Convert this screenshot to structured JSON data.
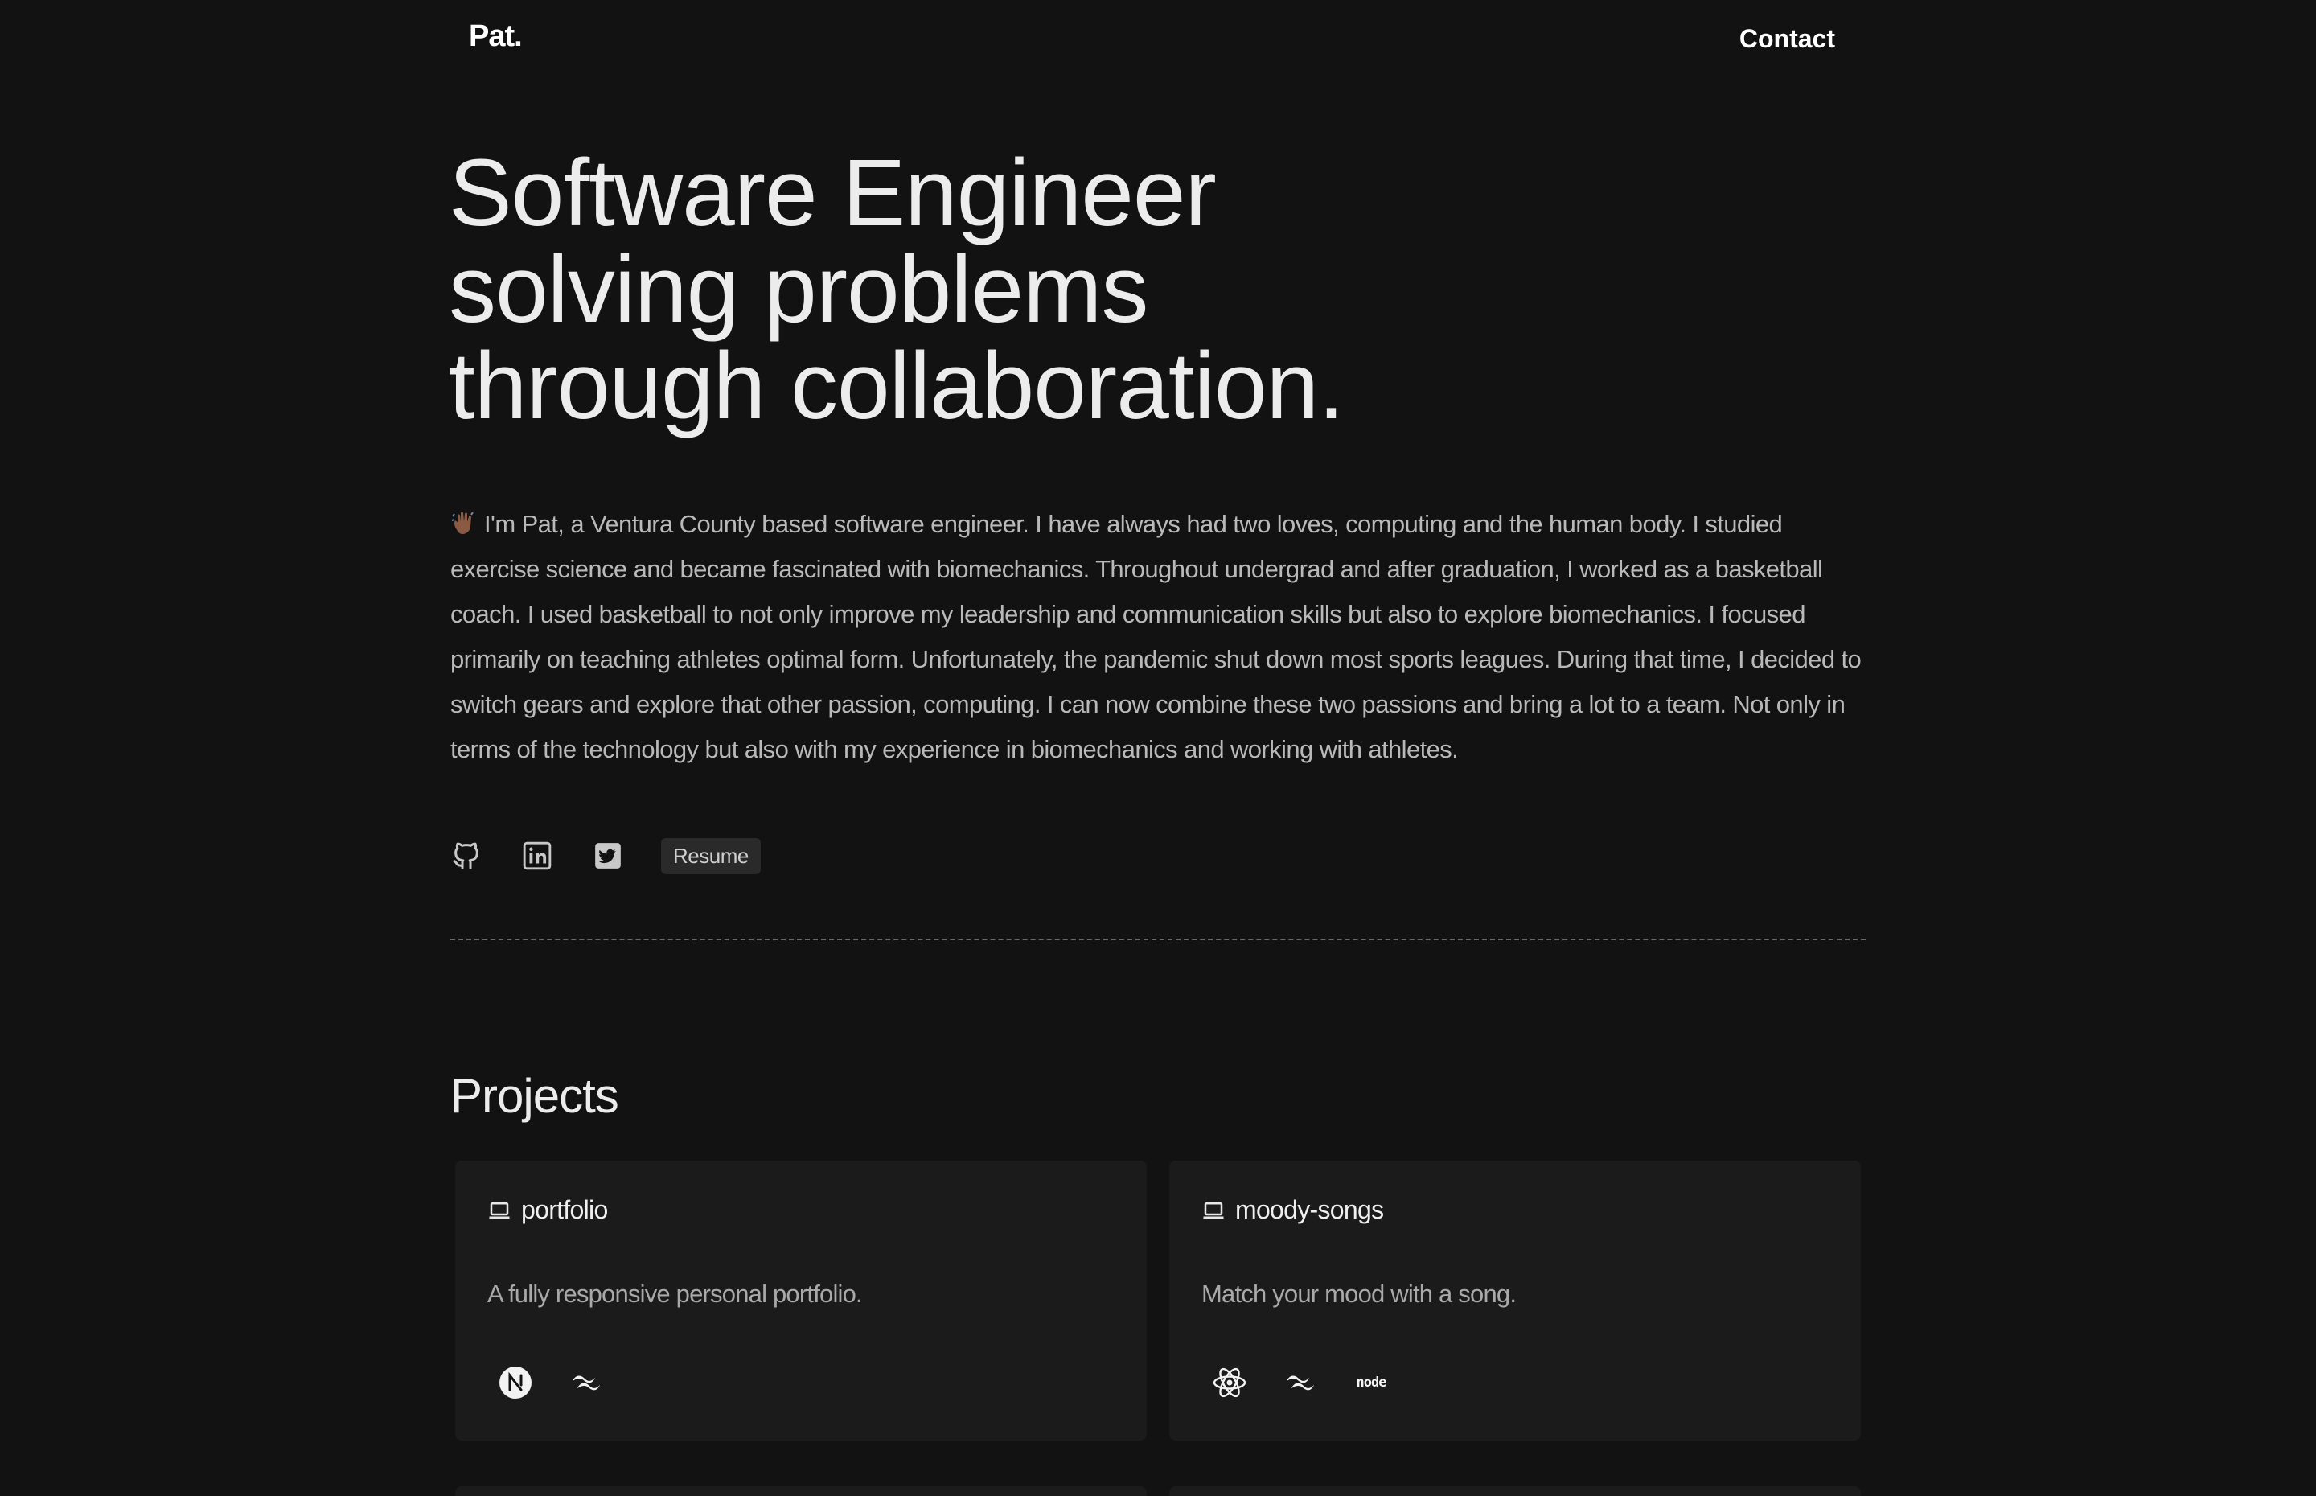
{
  "nav": {
    "brand": "Pat.",
    "contact": "Contact"
  },
  "hero": {
    "title_lines": [
      "Software Engineer",
      "solving problems",
      "through collaboration."
    ],
    "bio": "I'm Pat, a Ventura County based software engineer. I have always had two loves, computing and the human body. I studied exercise science and became fascinated with biomechanics. Throughout undergrad and after graduation, I worked as a basketball coach. I used basketball to not only improve my leadership and communication skills but also to explore biomechanics. I focused primarily on teaching athletes optimal form. Unfortunately, the pandemic shut down most sports leagues. During that time, I decided to switch gears and explore that other passion, computing. I can now combine these two passions and bring a lot to a team. Not only in terms of the technology but also with my experience in biomechanics and working with athletes.",
    "bio_icon": "waving-hand-icon"
  },
  "socials": {
    "icons": [
      "github-icon",
      "linkedin-icon",
      "twitter-icon"
    ],
    "resume_label": "Resume"
  },
  "projects": {
    "heading": "Projects",
    "items": [
      {
        "name": "portfolio",
        "description": "A fully responsive personal portfolio.",
        "tech_icons": [
          "nextjs-icon",
          "tailwind-icon"
        ]
      },
      {
        "name": "moody-songs",
        "description": "Match your mood with a song.",
        "tech_icons": [
          "react-icon",
          "tailwind-icon",
          "nodejs-icon"
        ],
        "node_label": "node"
      }
    ]
  },
  "colors": {
    "background": "#121212",
    "card": "#1b1b1b",
    "text": "#e6e6e6",
    "muted": "#b9b9b9"
  }
}
